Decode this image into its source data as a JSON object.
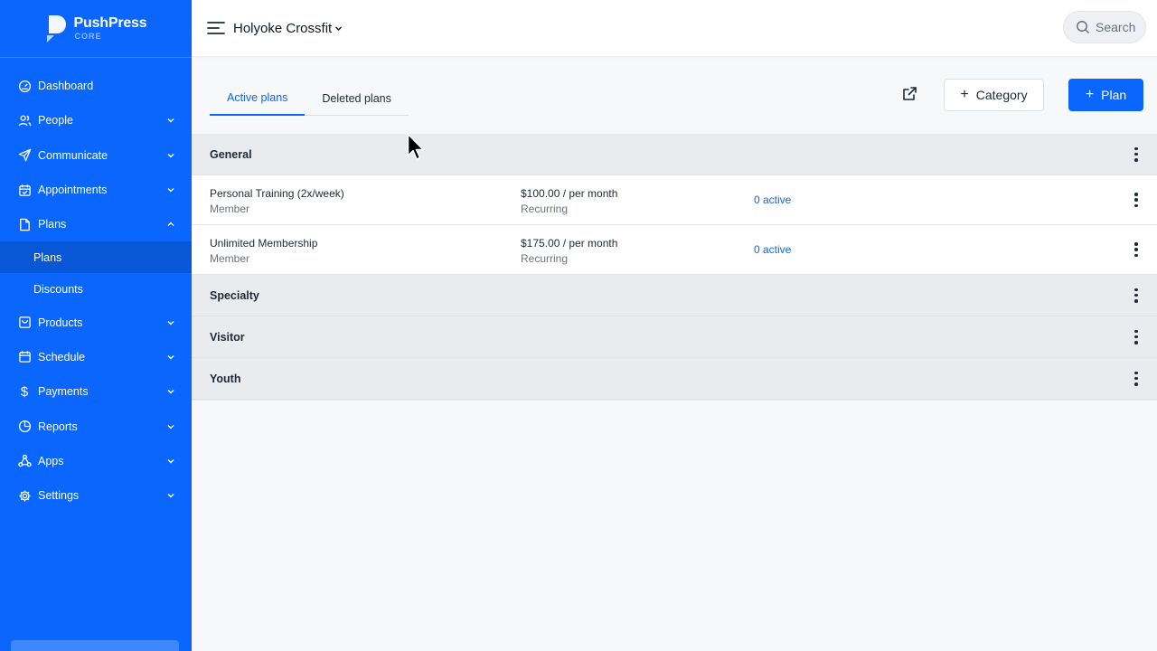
{
  "brand": {
    "name": "PushPress",
    "sub": "CORE"
  },
  "sidebar": {
    "items": [
      {
        "label": "Dashboard",
        "icon": "dashboard-icon",
        "chevron": false
      },
      {
        "label": "People",
        "icon": "people-icon",
        "chevron": "down"
      },
      {
        "label": "Communicate",
        "icon": "send-icon",
        "chevron": "down"
      },
      {
        "label": "Appointments",
        "icon": "calendar-check-icon",
        "chevron": "down"
      },
      {
        "label": "Plans",
        "icon": "document-icon",
        "chevron": "up"
      },
      {
        "label": "Products",
        "icon": "bag-icon",
        "chevron": "down"
      },
      {
        "label": "Schedule",
        "icon": "calendar-icon",
        "chevron": "down"
      },
      {
        "label": "Payments",
        "icon": "dollar-icon",
        "chevron": "down"
      },
      {
        "label": "Reports",
        "icon": "pie-chart-icon",
        "chevron": "down"
      },
      {
        "label": "Apps",
        "icon": "apps-icon",
        "chevron": "down"
      },
      {
        "label": "Settings",
        "icon": "gear-icon",
        "chevron": "down"
      }
    ],
    "plans_sub": [
      {
        "label": "Plans",
        "active": true
      },
      {
        "label": "Discounts",
        "active": false
      }
    ]
  },
  "topbar": {
    "org_name": "Holyoke Crossfit",
    "search_label": "Search"
  },
  "tabs": [
    {
      "label": "Active plans",
      "active": true
    },
    {
      "label": "Deleted plans",
      "active": false
    }
  ],
  "buttons": {
    "category": "Category",
    "plan": "Plan"
  },
  "categories": [
    {
      "name": "General",
      "plans": [
        {
          "name": "Personal Training (2x/week)",
          "type": "Member",
          "price": "$100.00 / per month",
          "billing": "Recurring",
          "active": "0 active"
        },
        {
          "name": "Unlimited Membership",
          "type": "Member",
          "price": "$175.00 / per month",
          "billing": "Recurring",
          "active": "0 active"
        }
      ]
    },
    {
      "name": "Specialty",
      "plans": []
    },
    {
      "name": "Visitor",
      "plans": []
    },
    {
      "name": "Youth",
      "plans": []
    }
  ],
  "colors": {
    "brand": "#0a66fc",
    "sidebar_active": "#0857d6",
    "category_bg": "#e9ebee"
  }
}
